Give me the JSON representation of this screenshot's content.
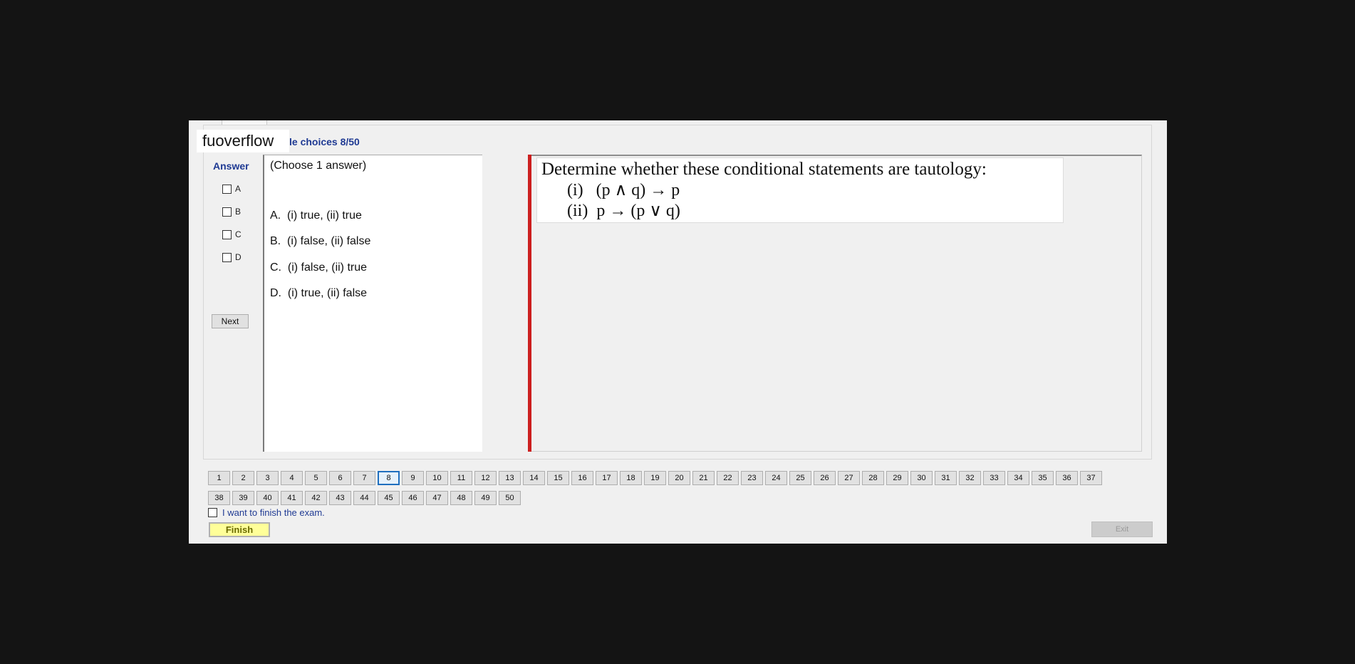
{
  "brand": "fuoverflow",
  "section_title": "le choices 8/50",
  "answer_panel": {
    "label": "Answer",
    "options": [
      "A",
      "B",
      "C",
      "D"
    ],
    "next_label": "Next"
  },
  "choices_panel": {
    "hint": "(Choose 1 answer)",
    "choices": [
      {
        "letter": "A.",
        "text": "(i) true, (ii) true"
      },
      {
        "letter": "B.",
        "text": "(i) false, (ii) false"
      },
      {
        "letter": "C.",
        "text": "(i) false, (ii) true"
      },
      {
        "letter": "D.",
        "text": "(i) true, (ii) false"
      }
    ]
  },
  "question": {
    "stem": "Determine whether these conditional statements are tautology:",
    "items": [
      {
        "num": "(i)",
        "expr": "(p ∧ q) → p"
      },
      {
        "num": "(ii)",
        "expr": "p → (p ∨ q)"
      }
    ]
  },
  "navigator": {
    "current": "8",
    "row1": [
      "1",
      "2",
      "3",
      "4",
      "5",
      "6",
      "7",
      "8",
      "9",
      "10",
      "11",
      "12",
      "13",
      "14",
      "15",
      "16",
      "17",
      "18",
      "19",
      "20",
      "21",
      "22",
      "23",
      "24",
      "25",
      "26",
      "27",
      "28",
      "29",
      "30",
      "31",
      "32",
      "33",
      "34",
      "35",
      "36",
      "37"
    ],
    "row2": [
      "38",
      "39",
      "40",
      "41",
      "42",
      "43",
      "44",
      "45",
      "46",
      "47",
      "48",
      "49",
      "50"
    ]
  },
  "footer": {
    "finish_check_label": "I want to finish the exam.",
    "finish_label": "Finish",
    "exit_label": "Exit"
  },
  "colors": {
    "accent_blue": "#1f3a93",
    "splitter_red": "#cc1f1f",
    "finish_yellow": "#ffff99"
  }
}
